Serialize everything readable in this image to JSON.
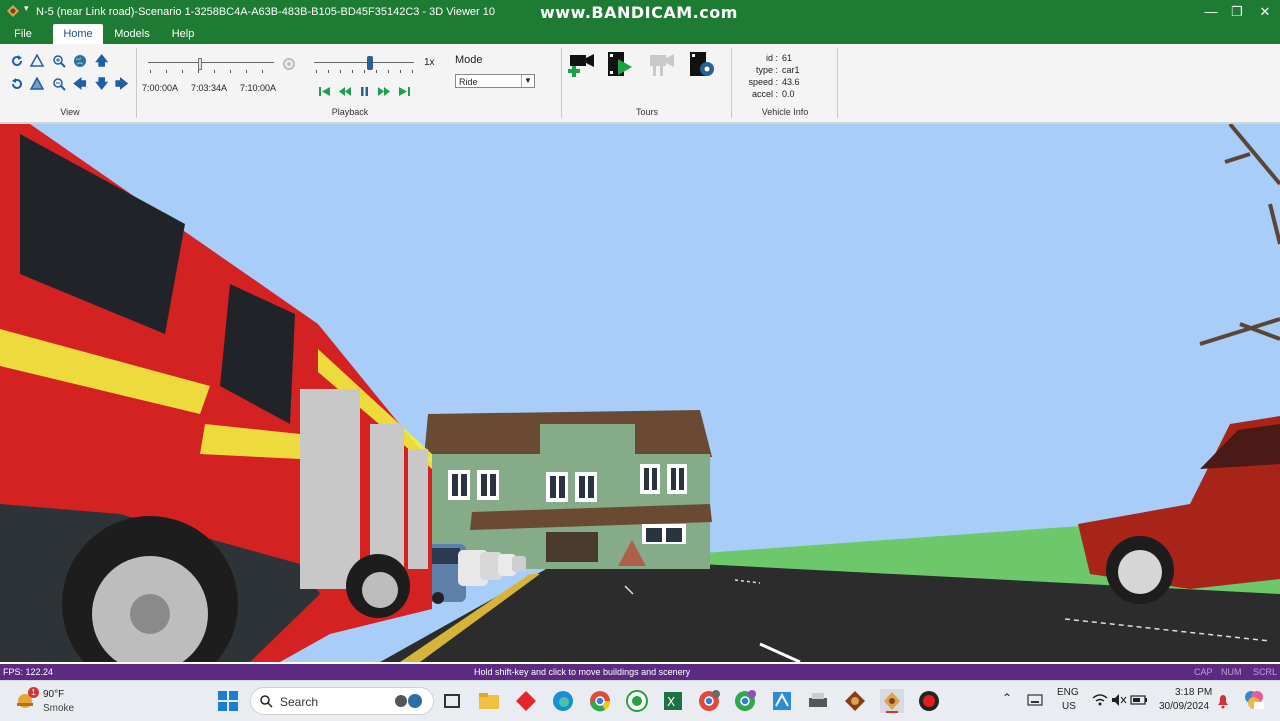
{
  "window": {
    "title": "N-5 (near Link road)-Scenario 1-3258BC4A-A63B-483B-B105-BD45F35142C3 - 3D Viewer 10",
    "quick_access": "▾",
    "watermark": "www.BANDICAM.com",
    "controls": {
      "minimize": "—",
      "restore": "❐",
      "close": "✕"
    }
  },
  "menu": {
    "file": "File",
    "home": "Home",
    "models": "Models",
    "help": "Help"
  },
  "ribbon": {
    "view_group": "View",
    "playback_group": "Playback",
    "tours_group": "Tours",
    "vehicle_group": "Vehicle Info",
    "time_labels": [
      "7:00:00A",
      "7:03:34A",
      "7:10:00A"
    ],
    "timeline_position": 0.41,
    "speed_label": "1x",
    "speed_position": 0.56,
    "mode_label": "Mode",
    "mode_value": "Ride"
  },
  "vehicle_info": {
    "id_key": "id :",
    "id": "61",
    "type_key": "type :",
    "type": "car1",
    "speed_key": "speed :",
    "speed": "43.6",
    "accel_key": "accel :",
    "accel": "0.0"
  },
  "status": {
    "fps": "FPS: 122.24",
    "hint": "Hold shift-key and click to move buildings and scenery",
    "cap": "CAP",
    "num": "NUM",
    "scrl": "SCRL"
  },
  "taskbar": {
    "weather_temp": "90°F",
    "weather_desc": "Smoke",
    "weather_badge": "1",
    "search_placeholder": "Search",
    "lang": "ENG",
    "region": "US",
    "time": "3:18 PM",
    "date": "30/09/2024"
  },
  "colors": {
    "titlebar": "#1e7b34",
    "statusbar": "#5c2a82",
    "sky": "#a8cdf8",
    "grass": "#6cc86a",
    "road": "#2c2c2c",
    "firetruck": "#d42222",
    "house_wall": "#86ab88",
    "roof": "#6a4a32"
  }
}
